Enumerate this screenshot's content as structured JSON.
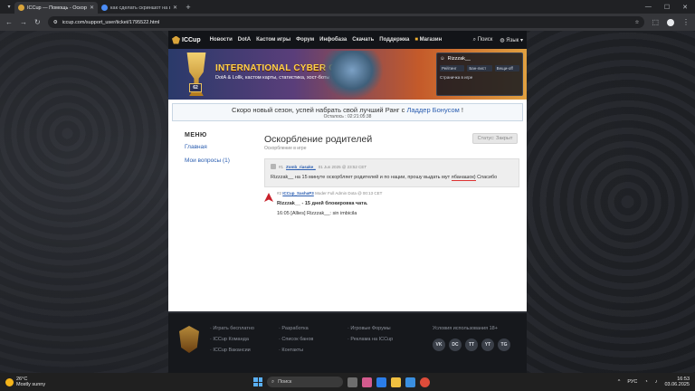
{
  "browser": {
    "tabs": [
      {
        "title": "ICCup — Помощь - Оскорблен",
        "active": true
      },
      {
        "title": "как сделать скриншот на вин",
        "active": false
      }
    ],
    "url": "iccup.com/support_user/ticket/1795522.html"
  },
  "site": {
    "logo": "ICCup",
    "nav": [
      "Новости",
      "DotA",
      "Кастом игры",
      "Форум",
      "Инфобаза",
      "Скачать",
      "Поддержка",
      "Магазин"
    ],
    "search_label": "Поиск",
    "lang_label": "Язык",
    "banner": {
      "title": "INTERNATIONAL CYBER CUP",
      "subtitle": "DotA & Lollk, кастом карты, статистика, хост-боты",
      "badge": "62"
    },
    "user_panel": {
      "username": "Rizzzak__",
      "stats": [
        "Рейтинг",
        "Бан-лист",
        "Вещи-off"
      ],
      "line2": "Страничка в игре"
    }
  },
  "notice": {
    "text_before": "Скоро новый сезон, успей набрать свой лучший Ранг с ",
    "link": "Ладдер Бонусом",
    "text_after": " !",
    "countdown": "Осталось : 02:21:05:38"
  },
  "sidebar": {
    "title": "МЕНЮ",
    "links": [
      "Главная",
      "Мои вопросы (1)"
    ]
  },
  "ticket": {
    "title": "Оскорбление родителей",
    "category": "Оскорбление в игре",
    "status": "Статус: Закрыт",
    "message": {
      "num": "#1",
      "author": "Zomb_riasake_",
      "date": "01 Jun 2025 @ 23:52 CET",
      "text_before": "Rizzzak__ на 15 минуте оскорбляет родителей и по нации, прошу выдать мут ",
      "highlight": "ябанашок)",
      "text_after": " Спасибо"
    },
    "reply": {
      "num": "#2",
      "author": "ICCup_SashaP3",
      "role": "Moder Full Admin Dota @ 00:13 CET",
      "line1": "Rizzzak__ - 15 дней блокировка чата.",
      "line2": "16:05 [Allies] Rizzzak__: sin imbicila"
    }
  },
  "footer": {
    "col1": [
      "Играть бесплатно",
      "ICCup Команда",
      "ICCup Вакансии"
    ],
    "col2": [
      "Разработка",
      "Список банов",
      "Контакты"
    ],
    "col3": [
      "Игровые Форумы",
      "Реклама на ICCup"
    ],
    "terms": "Условия использования 18+",
    "social": [
      "VK",
      "DC",
      "TT",
      "YT",
      "TG"
    ]
  },
  "taskbar": {
    "temp": "26°C",
    "weather": "Mostly sunny",
    "search": "Поиск",
    "lang": "РУС",
    "time": "16:53",
    "date": "03.06.2025"
  }
}
